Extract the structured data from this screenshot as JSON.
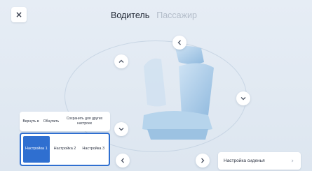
{
  "close": {
    "icon": "close-icon",
    "glyph": "×"
  },
  "tabs": [
    {
      "label": "Водитель",
      "active": true
    },
    {
      "label": "Пассажир",
      "active": false
    }
  ],
  "actions": [
    {
      "label": "Вернуть в"
    },
    {
      "label": "Обнулить"
    },
    {
      "label": "Сохранить для других настроек"
    }
  ],
  "presets": [
    {
      "label": "Настройка 1",
      "active": true
    },
    {
      "label": "Настройка 2",
      "active": false
    },
    {
      "label": "Настройка 3",
      "active": false
    }
  ],
  "seat_settings": {
    "label": "Настройка сиденья",
    "chevron": "›"
  },
  "colors": {
    "accent": "#2f6fd0",
    "seat": "#a9cce8",
    "background": "#e2eaf3"
  }
}
